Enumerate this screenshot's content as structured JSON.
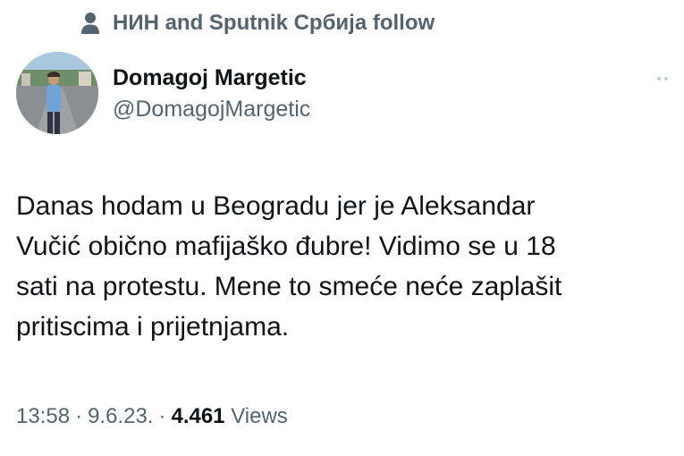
{
  "social_context": {
    "icon": "person-icon",
    "text": "НИН and Sputnik Србија follow"
  },
  "author": {
    "display_name": "Domagoj Margetic",
    "handle": "@DomagojMargetic",
    "avatar": "avatar"
  },
  "more_icon": "more-icon",
  "tweet": {
    "text": "Danas hodam u Beogradu jer je Aleksandar\nVučić obično mafijaško đubre! Vidimo se u 18\nsati na protestu. Mene to smeće neće zaplašit\npritiscima i prijetnjama."
  },
  "meta": {
    "time": "13:58",
    "separator": "·",
    "date": "9.6.23.",
    "views_count": "4.461",
    "views_label": "Views"
  },
  "colors": {
    "primary_text": "#0f1419",
    "secondary_text": "#536471",
    "background": "#ffffff"
  }
}
